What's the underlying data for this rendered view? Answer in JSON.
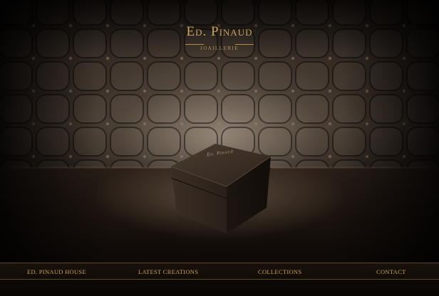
{
  "brand": {
    "name": "Ed. Pinaud",
    "subtitle": "JOAILLERIE",
    "box_label": "Ed. Pinaud"
  },
  "nav": {
    "items": [
      {
        "label": "ED. PINAUD HOUSE"
      },
      {
        "label": "LATEST CREATIONS"
      },
      {
        "label": "COLLECTIONS"
      },
      {
        "label": "CONTACT"
      }
    ]
  },
  "colors": {
    "accent_gold": "#c8a258",
    "background": "#0b0806",
    "leather": "#3a2f27"
  }
}
